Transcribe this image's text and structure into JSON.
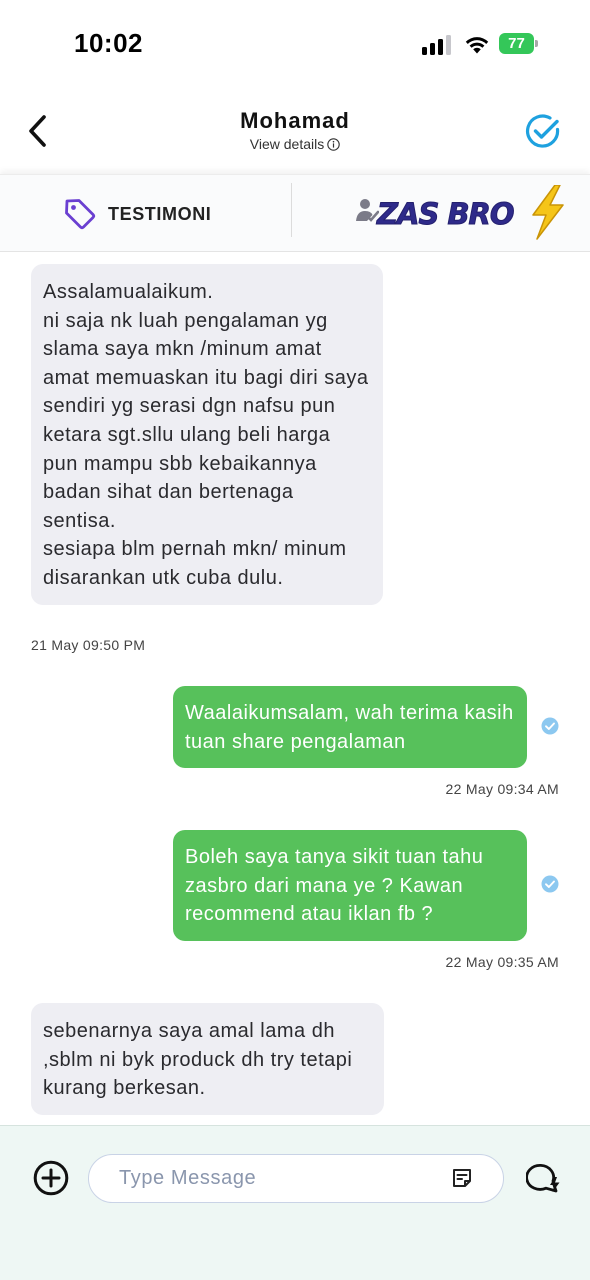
{
  "status_bar": {
    "time": "10:02",
    "battery_level": "77",
    "signal_bars_active": 3,
    "signal_bars_total": 4,
    "battery_color": "#34c759"
  },
  "header": {
    "contact_name": "Mohamad",
    "view_details": "View details",
    "icons": {
      "back": "chevron-left-icon",
      "info": "info-icon",
      "verify": "check-circle-icon"
    },
    "accent_color": "#1ea1df"
  },
  "tabs": {
    "testimoni_label": "TESTIMONI",
    "brand_label": "ZAS BRO",
    "icons": {
      "testimoni": "tag-icon",
      "brand": "zasbro-logo"
    },
    "tag_color": "#6a3fd1"
  },
  "messages": [
    {
      "direction": "incoming",
      "text": "Assalamualaikum.\nni saja nk luah pengalaman yg slama saya mkn /minum amat amat memuaskan itu bagi diri saya sendiri yg serasi dgn nafsu pun ketara sgt.sllu ulang beli harga pun mampu sbb kebaikannya badan sihat dan bertenaga sentisa.\nsesiapa  blm pernah mkn/ minum  disarankan utk cuba dulu.",
      "time": "21 May 09:50 PM"
    },
    {
      "direction": "outgoing",
      "text": "Waalaikumsalam, wah terima kasih tuan share pengalaman",
      "time": "22 May 09:34 AM",
      "read": true
    },
    {
      "direction": "outgoing",
      "text": "Boleh saya tanya sikit tuan tahu zasbro dari mana ye ? Kawan recommend atau iklan fb ?",
      "time": "22 May 09:35 AM",
      "read": true
    },
    {
      "direction": "incoming",
      "text": "sebenarnya saya amal lama dh ,sblm ni byk produck dh try tetapi kurang berkesan."
    }
  ],
  "colors": {
    "outgoing_bubble": "#57c15b",
    "incoming_bubble": "#eeeef3",
    "read_check": "#8cc8f0"
  },
  "composer": {
    "placeholder": "Type Message",
    "icons": {
      "add": "plus-circle-icon",
      "template": "note-icon",
      "quick_reply": "chat-bolt-icon"
    }
  }
}
